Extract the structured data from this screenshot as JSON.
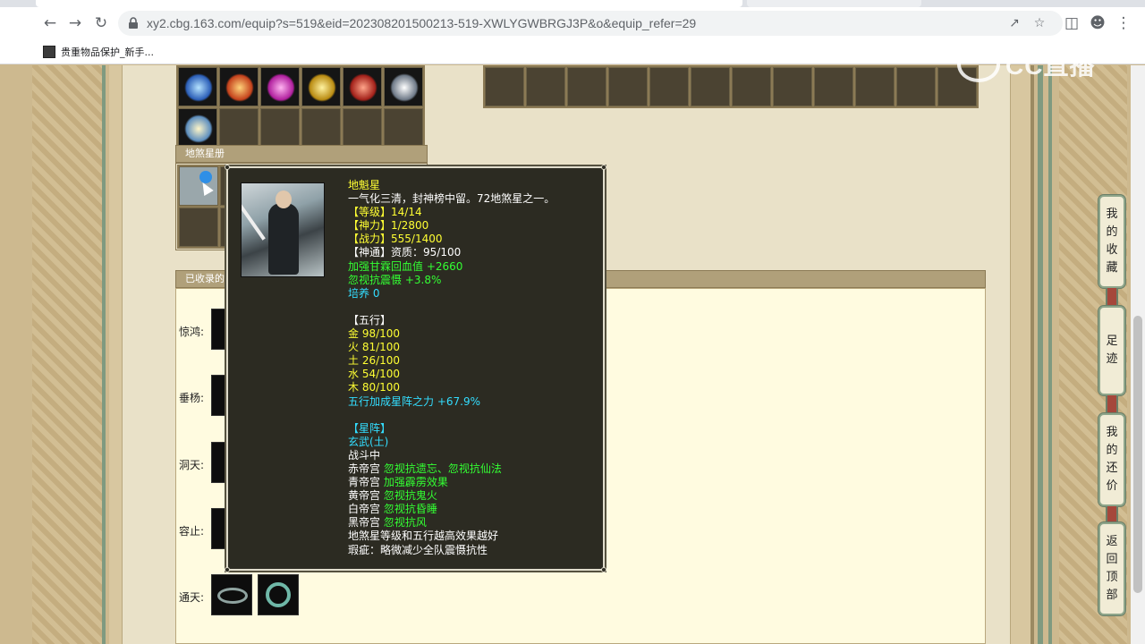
{
  "browser": {
    "url": "xy2.cbg.163.com/equip?s=519&eid=202308201500213-519-XWLYGWBRGJ3P&o&equip_refer=29",
    "bookmark_label": "贵重物品保护_新手..."
  },
  "watermark": "CC直播",
  "sections": {
    "stars_title": "地煞星册",
    "collect_title": "已收录的"
  },
  "collect_rows": [
    {
      "label": "惊鸿:"
    },
    {
      "label": "垂杨:"
    },
    {
      "label": "洞天:"
    },
    {
      "label": "容止:"
    },
    {
      "label": "通天:"
    }
  ],
  "tooltip": {
    "name": "地魁星",
    "desc": "一气化三清，封神榜中留。72地煞星之一。",
    "level": "【等级】14/14",
    "power": "【神力】1/2800",
    "battle": "【战力】555/1400",
    "aptitude": "【神通】资质：95/100",
    "bonus1": "加强甘霖回血值 +2660",
    "bonus2": "忽视抗震慑 +3.8%",
    "cultivate": "培养 0",
    "wuxing_title": "【五行】",
    "gold": "金 98/100",
    "fire": "火 81/100",
    "earth": "土 26/100",
    "water": "水 54/100",
    "wood": "木 80/100",
    "wuxing_bonus": "五行加成星阵之力 +67.9%",
    "formation_title": "【星阵】",
    "formation_name": "玄武(土)",
    "in_battle": "战斗中",
    "palaces": [
      {
        "name": "赤帝宫",
        "effect": "忽视抗遗忘、忽视抗仙法"
      },
      {
        "name": "青帝宫",
        "effect": "加强霹雳效果"
      },
      {
        "name": "黄帝宫",
        "effect": "忽视抗鬼火"
      },
      {
        "name": "白帝宫",
        "effect": "忽视抗昏睡"
      },
      {
        "name": "黑帝宫",
        "effect": "忽视抗风"
      }
    ],
    "note": "地煞星等级和五行越高效果越好",
    "flaw": "瑕疵：略微减少全队震慑抗性"
  },
  "side_buttons": [
    {
      "label": [
        "我",
        "的",
        "收",
        "藏"
      ]
    },
    {
      "label": [
        "足",
        "迹"
      ]
    },
    {
      "label": [
        "我",
        "的",
        "还",
        "价"
      ]
    },
    {
      "label": [
        "返",
        "回",
        "顶",
        "部"
      ]
    }
  ],
  "colors": {
    "tooltip_bg": "#2c2b22",
    "yellow": "#ffff33",
    "green": "#33ff33",
    "cyan": "#33ddff"
  }
}
